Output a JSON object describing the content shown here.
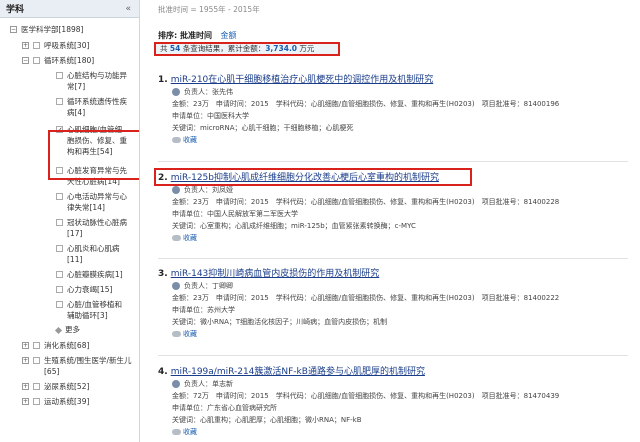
{
  "sidebar": {
    "title": "学科",
    "root": {
      "label": "医学科学部[1898]"
    },
    "items": [
      {
        "label": "呼吸系统[30]"
      },
      {
        "label": "循环系统[180]"
      },
      {
        "label": "消化系统[68]"
      },
      {
        "label": "生殖系统/围生医学/新生儿[65]"
      },
      {
        "label": "泌尿系统[52]"
      },
      {
        "label": "运动系统[39]"
      }
    ],
    "sub_items": [
      {
        "label": "心脏结构与功能异常[7]",
        "checked": false
      },
      {
        "label": "循环系统遗传性疾病[4]",
        "checked": false
      },
      {
        "label": "心肌细胞/血管细胞损伤、修复、重构和再生[54]",
        "checked": true
      },
      {
        "label": "心脏发育异常与先天性心脏病[14]",
        "checked": false
      },
      {
        "label": "心电活动异常与心律失常[14]",
        "checked": false
      },
      {
        "label": "冠状动脉性心脏病[17]",
        "checked": false
      },
      {
        "label": "心肌炎和心肌病[11]",
        "checked": false
      },
      {
        "label": "心脏瓣膜疾病[1]",
        "checked": false
      },
      {
        "label": "心力衰竭[15]",
        "checked": false
      },
      {
        "label": "心脏/血管移植和辅助循环[3]",
        "checked": false
      }
    ],
    "more_label": "更多"
  },
  "main": {
    "approval_time": "批准时间 = 1955年 - 2015年",
    "sort_label": "排序: 批准时间",
    "sort_link": "金额",
    "total": {
      "prefix": "共 ",
      "count": "54",
      "mid": " 条查询结果，累计金额：",
      "amount": "3,734.0",
      "suffix": " 万元"
    },
    "records": [
      {
        "index": "1.",
        "title": "miR-210在心肌干细胞移植治疗心肌梗死中的调控作用及机制研究",
        "person": "负责人：张先伟",
        "details": "金额：23万　申请时间：2015　学科代码：心肌细胞/血管细胞损伤、修复、重构和再生(H0203)　项目批准号：81400196",
        "unit": "申请单位：中国医科大学",
        "keywords": "关键词：microRNA；心肌干细胞；干细胞移植；心肌梗死",
        "fav": "收藏"
      },
      {
        "index": "2.",
        "title": "miR-125b抑制心肌成纤维细胞分化改善心梗后心室重构的机制研究",
        "person": "负责人：刘凤娅",
        "details": "金额：23万　申请时间：2015　学科代码：心肌细胞/血管细胞损伤、修复、重构和再生(H0203)　项目批准号：81400228",
        "unit": "申请单位：中国人民解放军第二军医大学",
        "keywords": "关键词：心室重构；心肌成纤维细胞；miR-125b；血管紧张素转换酶；c-MYC",
        "fav": "收藏"
      },
      {
        "index": "3.",
        "title": "miR-143抑制川崎病血管内皮损伤的作用及机制研究",
        "person": "负责人：丁卿卿",
        "details": "金额：23万　申请时间：2015　学科代码：心肌细胞/血管细胞损伤、修复、重构和再生(H0203)　项目批准号：81400222",
        "unit": "申请单位：苏州大学",
        "keywords": "关键词：微小RNA；T细胞活化核因子；川崎病；血管内皮损伤；机制",
        "fav": "收藏"
      },
      {
        "index": "4.",
        "title": "miR-199a/miR-214簇激活NF-kB通路参与心肌肥厚的机制研究",
        "person": "负责人：单志新",
        "details": "金额：72万　申请时间：2015　学科代码：心肌细胞/血管细胞损伤、修复、重构和再生(H0203)　项目批准号：81470439",
        "unit": "申请单位：广东省心血管病研究所",
        "keywords": "关键词：心肌重构；心肌肥厚；心肌细胞；微小RNA；NF-kB",
        "fav": "收藏"
      }
    ]
  }
}
